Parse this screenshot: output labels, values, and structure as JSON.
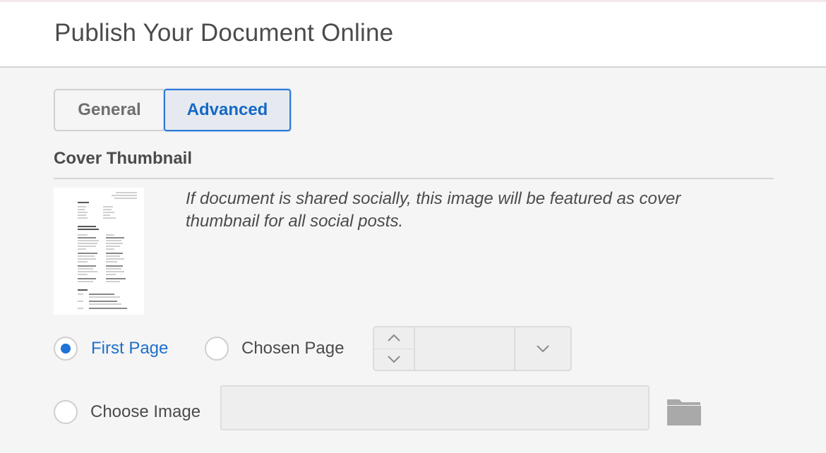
{
  "header": {
    "title": "Publish Your Document Online"
  },
  "tabs": [
    {
      "label": "General",
      "selected": false
    },
    {
      "label": "Advanced",
      "selected": true
    }
  ],
  "cover_thumbnail": {
    "section_title": "Cover Thumbnail",
    "description": "If document is shared socially, this image will be featured as cover thumbnail for all social posts.",
    "options": {
      "first_page": {
        "label": "First Page",
        "checked": true
      },
      "chosen_page": {
        "label": "Chosen Page",
        "checked": false,
        "page_value": ""
      },
      "choose_image": {
        "label": "Choose Image",
        "checked": false,
        "file_value": ""
      }
    }
  },
  "icons": {
    "stepper_up": "chevron-up-icon",
    "stepper_down": "chevron-down-icon",
    "dropdown": "chevron-down-icon",
    "browse": "folder-icon"
  },
  "colors": {
    "accent": "#1f73d6",
    "active_text": "#1f6fcb",
    "tab_border_active": "#2d7ad6",
    "text": "#4b4b4b",
    "panel_bg": "#f5f5f5",
    "folder_icon": "#a9a9a9"
  }
}
